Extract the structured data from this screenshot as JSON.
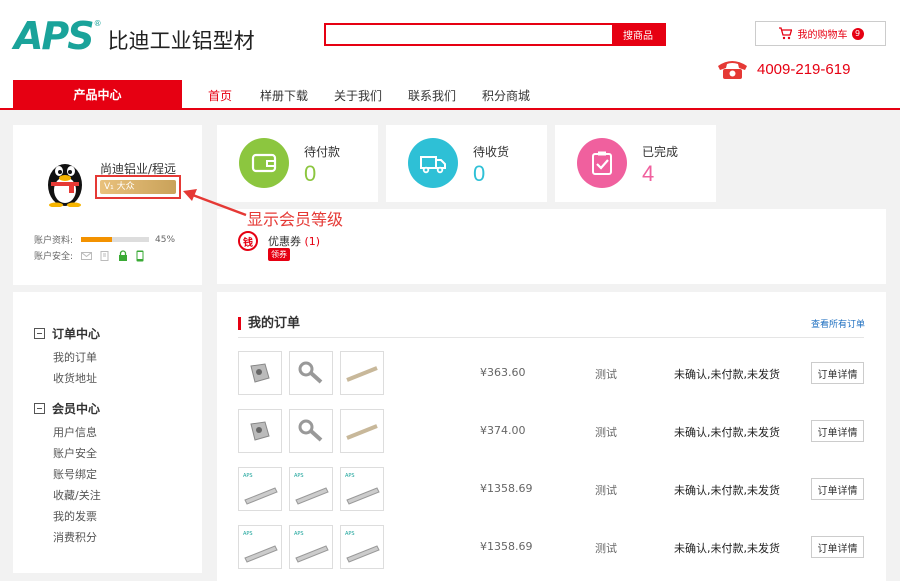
{
  "header": {
    "logo_mark": "APS",
    "logo_reg": "®",
    "logo_name": "比迪工业铝型材",
    "search_placeholder": "",
    "search_button": "搜商品",
    "cart_label": "我的购物车",
    "cart_count": "9",
    "phone": "4009-219-619"
  },
  "nav": {
    "product_center": "产品中心",
    "items": [
      "首页",
      "样册下载",
      "关于我们",
      "联系我们",
      "积分商城"
    ]
  },
  "user": {
    "name": "尚迪铝业/程远",
    "vip_level": "V₁ 大众",
    "account_info_label": "账户资料:",
    "account_progress": 0.45,
    "account_progress_text": "45%",
    "account_security_label": "账户安全:"
  },
  "stats": [
    {
      "label": "待付款",
      "value": "0",
      "color": "#8cc63f"
    },
    {
      "label": "待收货",
      "value": "0",
      "color": "#2ec0d6"
    },
    {
      "label": "已完成",
      "value": "4",
      "color": "#f0609e"
    }
  ],
  "coupon": {
    "icon_text": "钱",
    "label": "优惠券",
    "count": "(1)",
    "button": "领券"
  },
  "annotation": "显示会员等级",
  "menu": {
    "order_center": "订单中心",
    "order_items": [
      "我的订单",
      "收货地址"
    ],
    "member_center": "会员中心",
    "member_items": [
      "用户信息",
      "账户安全",
      "账号绑定",
      "收藏/关注",
      "我的发票",
      "消费积分"
    ]
  },
  "orders": {
    "title": "我的订单",
    "view_all": "查看所有订单",
    "rows": [
      {
        "price": "¥363.60",
        "note": "测试",
        "status": "未确认,未付款,未发货",
        "button": "订单详情"
      },
      {
        "price": "¥374.00",
        "note": "测试",
        "status": "未确认,未付款,未发货",
        "button": "订单详情"
      },
      {
        "price": "¥1358.69",
        "note": "测试",
        "status": "未确认,未付款,未发货",
        "button": "订单详情"
      },
      {
        "price": "¥1358.69",
        "note": "测试",
        "status": "未确认,未付款,未发货",
        "button": "订单详情"
      }
    ]
  },
  "colors": {
    "brand_red": "#e60012",
    "logo_teal": "#1aa39a",
    "link_blue": "#1e6fc0"
  }
}
